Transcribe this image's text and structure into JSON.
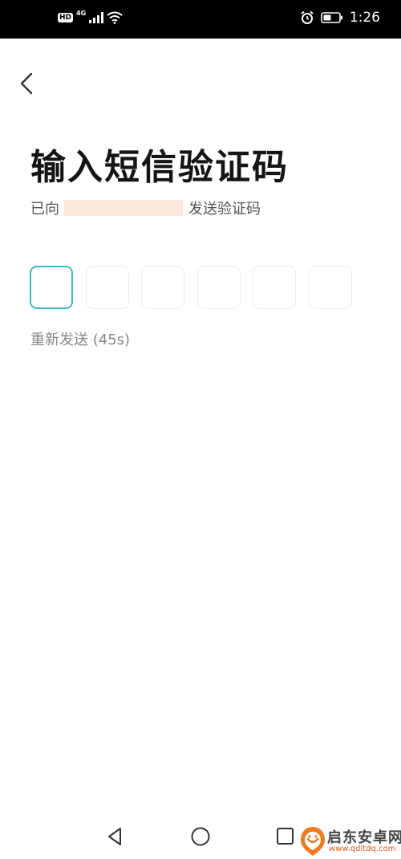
{
  "status_bar": {
    "hd_badge": "HD",
    "network_type": "4G",
    "time": "1:26",
    "icons": [
      "signal-icon",
      "wifi-icon",
      "alarm-icon",
      "battery-icon"
    ]
  },
  "header": {
    "back_icon": "chevron-left-icon"
  },
  "main": {
    "title": "输入短信验证码",
    "subtitle_prefix": "已向",
    "subtitle_suffix": "发送验证码",
    "code_length": 6,
    "active_box_color": "#38bcc9",
    "resend_label": "重新发送 (45s)"
  },
  "nav_bar": {
    "icons": [
      "back-triangle-icon",
      "home-circle-icon",
      "recents-square-icon"
    ]
  },
  "watermark": {
    "logo_text": "启东安卓网",
    "url": "www.qdltdq.com"
  }
}
